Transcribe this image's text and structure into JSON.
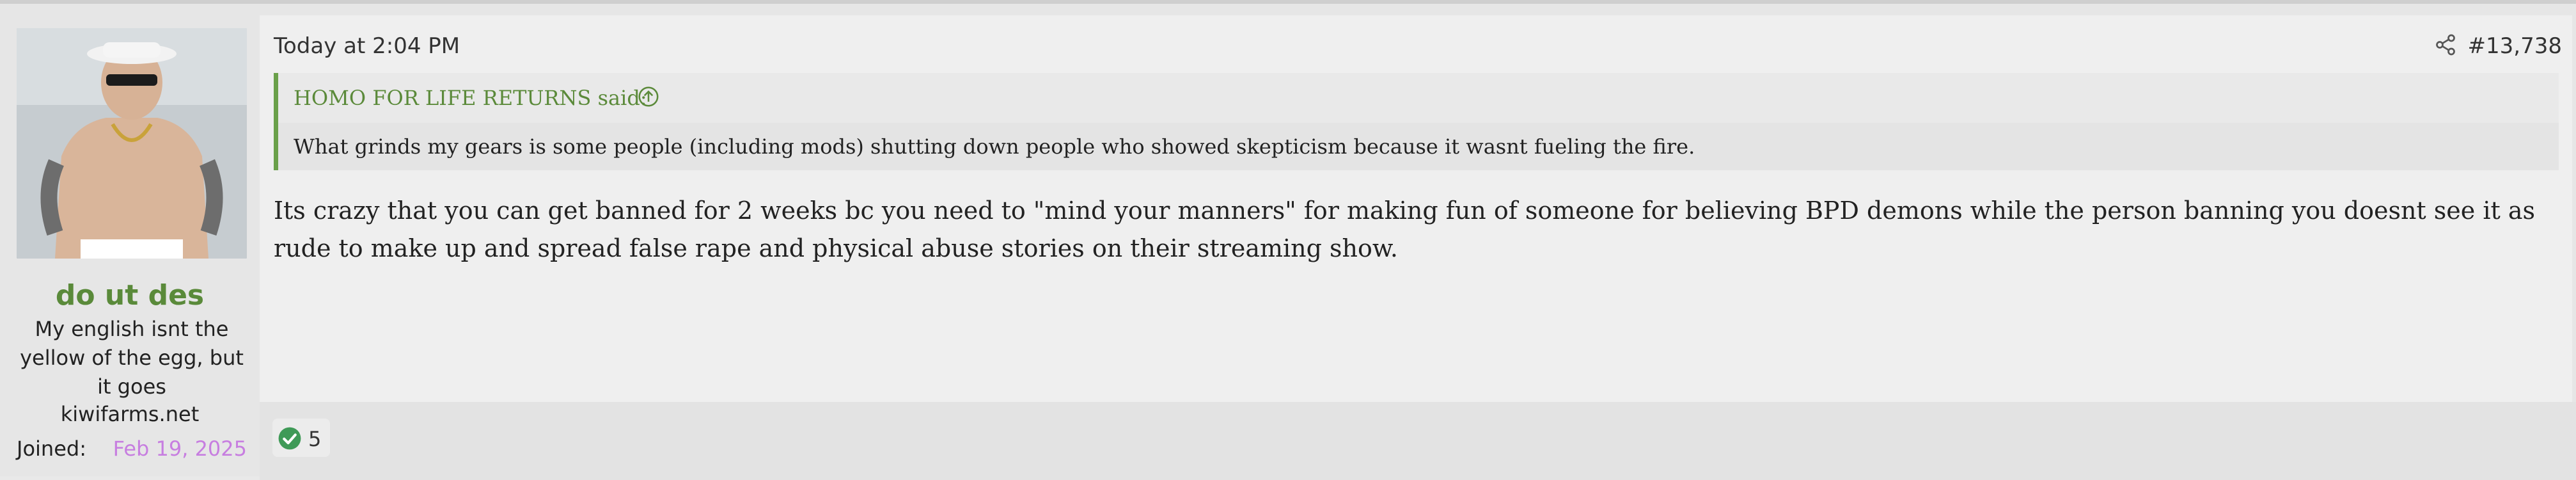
{
  "user": {
    "name": "do ut des",
    "title": "My english isnt the yellow of the egg, but it goes",
    "site": "kiwifarms.net",
    "joined_label": "Joined:",
    "joined_value": "Feb 19, 2025"
  },
  "post": {
    "date": "Today at 2:04 PM",
    "number": "#13,738",
    "quote": {
      "author": "HOMO FOR LIFE RETURNS said:",
      "text": "What grinds my gears is some people (including mods) shutting down people who showed skepticism because it wasnt fueling the fire."
    },
    "message": "Its crazy that you can get banned for 2 weeks bc you need to \"mind your manners\" for making fun of someone for believing BPD demons while the person banning you doesnt see it as rude to make up and spread false rape and physical abuse stories on their streaming show.",
    "reaction_count": "5"
  },
  "colors": {
    "username": "#5a8a3a",
    "quote_border": "#6aa04a",
    "joined_date": "#c77ee0"
  },
  "icons": [
    "share-icon",
    "arrow-up-circle-icon",
    "check-circle-icon"
  ]
}
